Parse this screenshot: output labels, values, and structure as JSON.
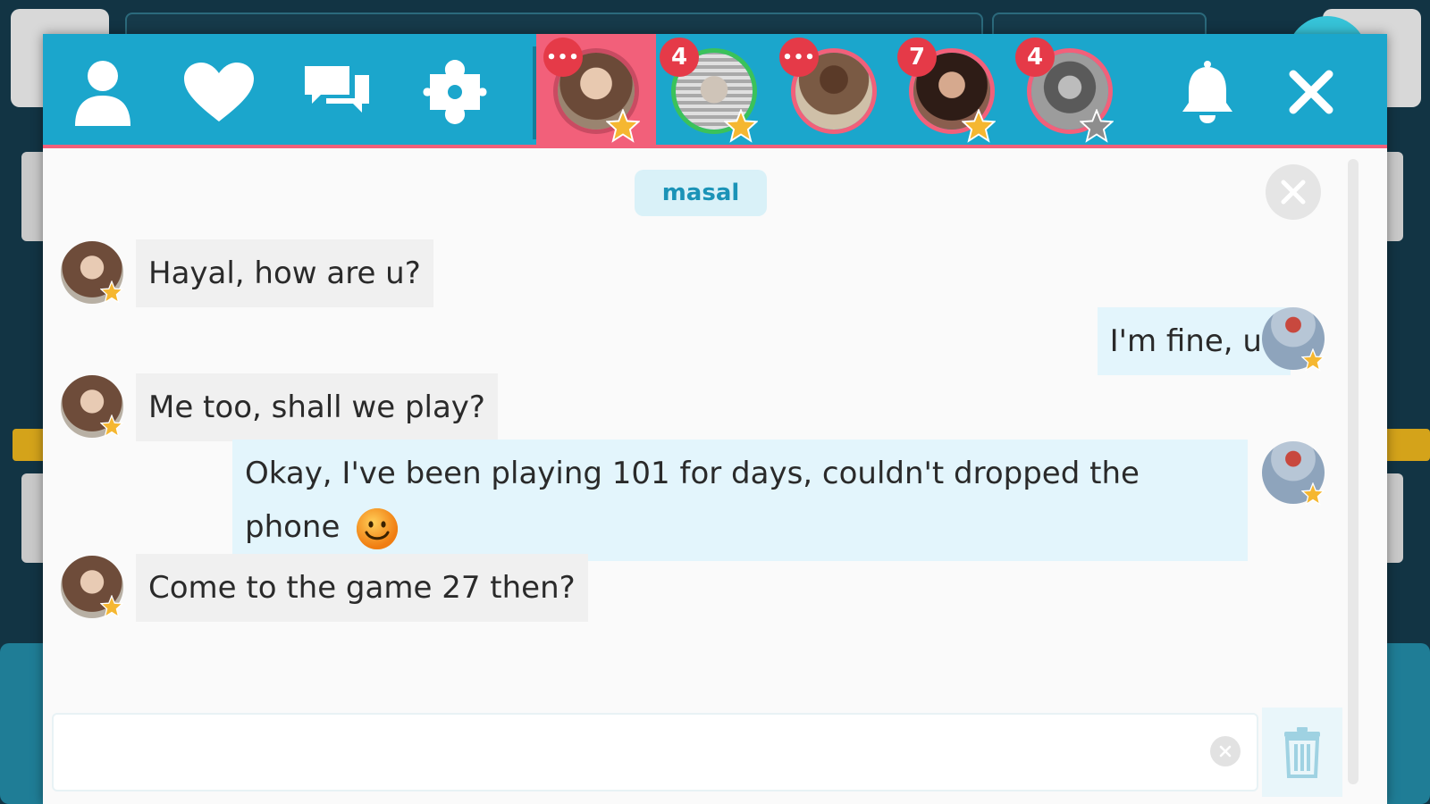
{
  "colors": {
    "topbar": "#1ba6cc",
    "accent_pink": "#f2607a",
    "badge_red": "#e53a48",
    "online_green": "#3bc25a",
    "star_gold": "#f5b731",
    "star_gray": "#8d8d8d",
    "incoming_bubble": "#f0f0f0",
    "outgoing_bubble": "#e3f5fc",
    "room_pill_text": "#1b93b7"
  },
  "topbar": {
    "nav_icons": [
      "user-icon",
      "heart-icon",
      "chat-icon",
      "puzzle-icon"
    ],
    "tabs": [
      {
        "badge": "•••",
        "star": "gold",
        "active": true,
        "online": false
      },
      {
        "badge": "4",
        "star": "gold",
        "active": false,
        "online": true
      },
      {
        "badge": "•••",
        "star": "none",
        "active": false,
        "online": false
      },
      {
        "badge": "7",
        "star": "gold",
        "active": false,
        "online": false
      },
      {
        "badge": "4",
        "star": "gray",
        "active": false,
        "online": false
      }
    ],
    "right_icons": [
      "bell-icon",
      "close-icon"
    ]
  },
  "chat": {
    "room_name": "masal",
    "messages": [
      {
        "direction": "in",
        "text": "Hayal, how are u?"
      },
      {
        "direction": "out",
        "text": "I'm fine, u?"
      },
      {
        "direction": "in",
        "text": "Me too, shall we play?"
      },
      {
        "direction": "out",
        "text_line1": "Okay, I've been playing 101 for days, couldn't dropped the",
        "text_line2": "phone",
        "emoji": "smiley-icon"
      },
      {
        "direction": "in",
        "text": "Come to the game 27 then?"
      }
    ]
  },
  "composer": {
    "placeholder": "",
    "value": ""
  }
}
